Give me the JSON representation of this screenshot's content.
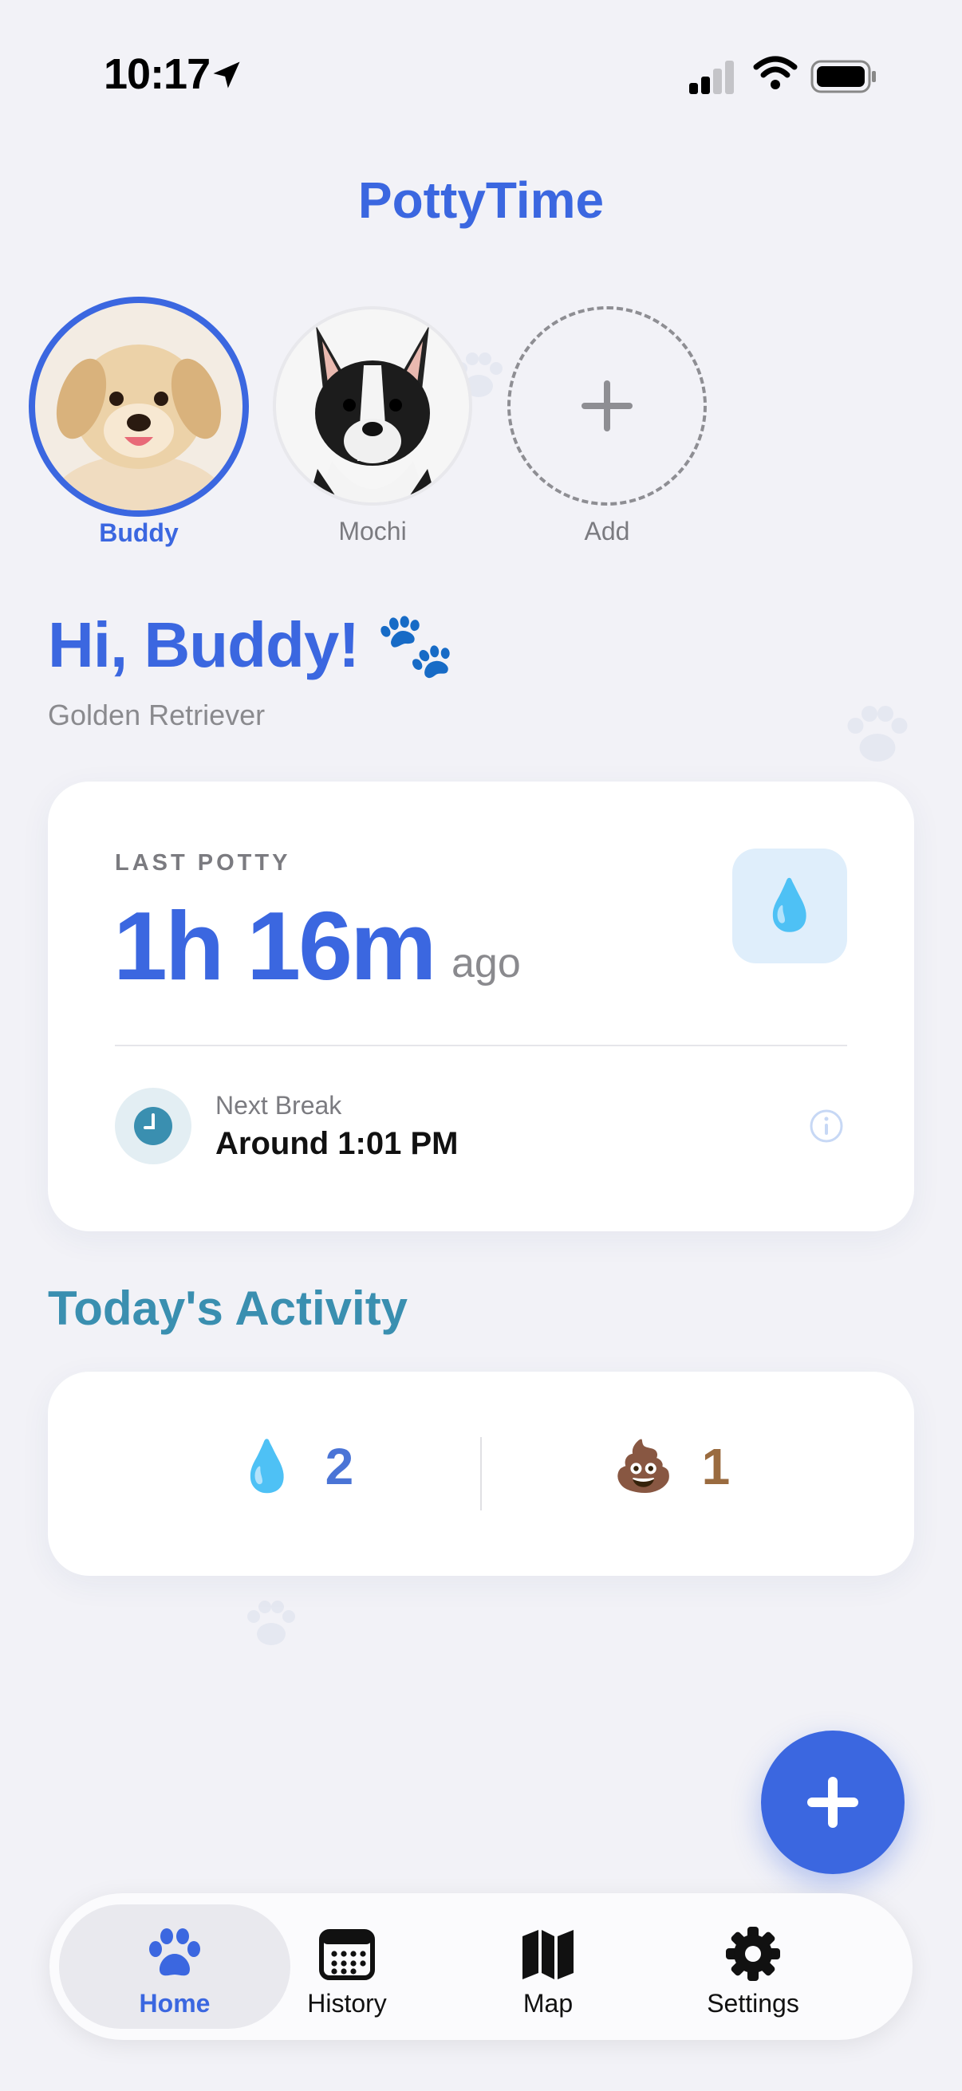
{
  "status_bar": {
    "time": "10:17"
  },
  "app": {
    "title": "PottyTime"
  },
  "pets": [
    {
      "name": "Buddy",
      "selected": true
    },
    {
      "name": "Mochi",
      "selected": false
    }
  ],
  "add_pet": {
    "label": "Add"
  },
  "greeting": {
    "text": "Hi, Buddy! 🐾",
    "breed": "Golden Retriever"
  },
  "last_potty": {
    "label": "LAST POTTY",
    "value": "1h 16m",
    "suffix": "ago",
    "type_icon": "💧"
  },
  "next_break": {
    "label": "Next Break",
    "value": "Around 1:01 PM"
  },
  "activity": {
    "title": "Today's Activity",
    "pee": {
      "icon": "💧",
      "count": "2"
    },
    "poop": {
      "icon": "💩",
      "count": "1"
    }
  },
  "tabs": [
    {
      "label": "Home",
      "active": true
    },
    {
      "label": "History",
      "active": false
    },
    {
      "label": "Map",
      "active": false
    },
    {
      "label": "Settings",
      "active": false
    }
  ],
  "colors": {
    "accent": "#3b67e0",
    "teal": "#3a8fb0",
    "poop_brown": "#9a6b3f",
    "background": "#f2f2f7"
  }
}
